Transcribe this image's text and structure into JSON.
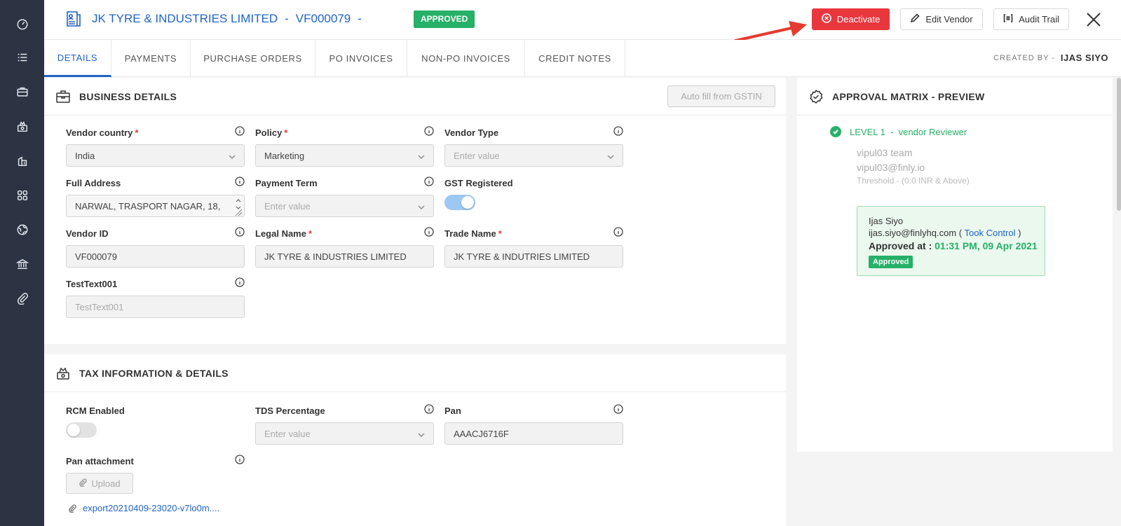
{
  "colors": {
    "sidebar": "#2c3443",
    "brand_blue": "#1f63c6",
    "approved_green": "#26b068",
    "deactivate_red": "#e9373e",
    "annotation_arrow": "#e53b2f"
  },
  "sidebar": {
    "icons": [
      "dashboard-icon",
      "list-icon",
      "briefcase-icon",
      "payments-icon",
      "invoice-icon",
      "apps-grid-icon",
      "globe-icon",
      "bank-icon",
      "attachment-icon"
    ]
  },
  "header": {
    "vendor_name": "JK TYRE & INDUSTRIES LIMITED",
    "sep1": "-",
    "vendor_code": "VF000079",
    "sep2": "-",
    "status": "APPROVED",
    "deactivate_label": "Deactivate",
    "edit_label": "Edit Vendor",
    "audit_label": "Audit Trail"
  },
  "tabs": [
    {
      "label": "DETAILS",
      "active": true
    },
    {
      "label": "PAYMENTS"
    },
    {
      "label": "PURCHASE ORDERS"
    },
    {
      "label": "PO INVOICES"
    },
    {
      "label": "NON-PO INVOICES"
    },
    {
      "label": "CREDIT NOTES"
    }
  ],
  "created_by": {
    "label": "CREATED BY -",
    "value": "IJAS SIYO"
  },
  "business": {
    "title": "BUSINESS DETAILS",
    "autofill_label": "Auto fill from GSTIN",
    "vendor_country": {
      "label": "Vendor country",
      "required": "*",
      "value": "India"
    },
    "policy": {
      "label": "Policy",
      "required": "*",
      "value": "Marketing"
    },
    "vendor_type": {
      "label": "Vendor Type",
      "placeholder": "Enter value"
    },
    "full_address": {
      "label": "Full Address",
      "value": "NARWAL, TRASPORT NAGAR, 18,"
    },
    "payment_term": {
      "label": "Payment Term",
      "placeholder": "Enter value"
    },
    "gst_registered": {
      "label": "GST Registered",
      "enabled": true
    },
    "vendor_id": {
      "label": "Vendor ID",
      "value": "VF000079"
    },
    "legal_name": {
      "label": "Legal Name",
      "required": "*",
      "value": "JK TYRE & INDUSTRIES LIMITED"
    },
    "trade_name": {
      "label": "Trade Name",
      "required": "*",
      "value": "JK TYRE & INDUTRIES LIMITED"
    },
    "test_text": {
      "label": "TestText001",
      "placeholder": "TestText001"
    }
  },
  "tax": {
    "title": "TAX INFORMATION & DETAILS",
    "rcm_enabled": {
      "label": "RCM Enabled",
      "enabled": false
    },
    "tds_percentage": {
      "label": "TDS Percentage",
      "placeholder": "Enter value"
    },
    "pan": {
      "label": "Pan",
      "value": "AAACJ6716F"
    },
    "pan_attachment": {
      "label": "Pan attachment",
      "upload_label": "Upload",
      "file_name": "export20210409-23020-v7lo0m...."
    }
  },
  "approval": {
    "title": "APPROVAL MATRIX - PREVIEW",
    "level": "LEVEL 1",
    "level_sep": "-",
    "level_role": "vendor Reviewer",
    "team": "vipul03 team",
    "email": "vipul03@finly.io",
    "threshold": "Threshold -  (0.0 INR   & Above)",
    "card": {
      "name": "Ijas Siyo",
      "email": "ijas.siyo@finlyhq.com (",
      "took_control": "Took Control",
      "email_close": ")",
      "approved_at_label": "Approved at :",
      "approved_at_value": "01:31 PM, 09 Apr 2021",
      "badge": "Approved"
    }
  }
}
